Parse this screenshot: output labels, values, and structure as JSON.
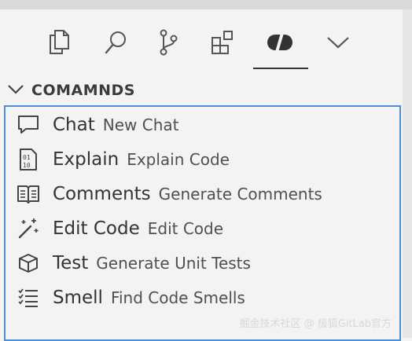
{
  "activity_bar": {
    "icons": [
      "explorer-icon",
      "search-icon",
      "source-control-icon",
      "extensions-icon",
      "gitlab-duo-icon",
      "more-chevron-icon"
    ],
    "active": "gitlab-duo-icon"
  },
  "section": {
    "title": "COMAMNDS"
  },
  "commands": [
    {
      "label": "Chat",
      "description": "New Chat",
      "icon": "chat-bubble-icon"
    },
    {
      "label": "Explain",
      "description": "Explain Code",
      "icon": "binary-file-icon"
    },
    {
      "label": "Comments",
      "description": "Generate Comments",
      "icon": "book-icon"
    },
    {
      "label": "Edit Code",
      "description": "Edit Code",
      "icon": "magic-wand-icon"
    },
    {
      "label": "Test",
      "description": "Generate Unit Tests",
      "icon": "cube-icon"
    },
    {
      "label": "Smell",
      "description": "Find Code Smells",
      "icon": "checklist-icon"
    }
  ],
  "watermark": "掘金技术社区 @ 极狐GitLab官方",
  "colors": {
    "background": "#f3f3f3",
    "focus_border": "#4a90d9",
    "text": "#333333"
  }
}
